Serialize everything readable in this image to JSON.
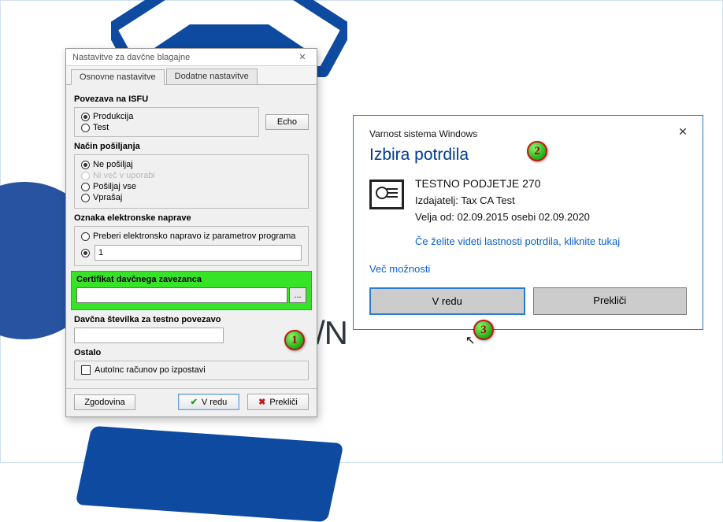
{
  "background": {
    "fragment_text": "/N"
  },
  "settings_window": {
    "title": "Nastavitve za davčne blagajne",
    "tabs": {
      "basic": "Osnovne nastavitve",
      "extra": "Dodatne nastavitve"
    },
    "isfu": {
      "label": "Povezava na ISFU",
      "production": "Produkcija",
      "test": "Test",
      "echo_btn": "Echo"
    },
    "send_mode": {
      "label": "Način pošiljanja",
      "none": "Ne pošiljaj",
      "deprecated": "Ni več v uporabi",
      "all": "Pošiljaj vse",
      "ask": "Vprašaj"
    },
    "device": {
      "label": "Oznaka elektronske naprave",
      "from_params": "Preberi elektronsko napravo iz parametrov programa",
      "value": "1"
    },
    "cert": {
      "label": "Certifikat davčnega zavezanca",
      "value": "",
      "browse": "..."
    },
    "tax_no": {
      "label": "Davčna številka za testno povezavo",
      "value": ""
    },
    "other": {
      "label": "Ostalo",
      "autoinc": "AutoInc računov po izpostavi"
    },
    "footer": {
      "history": "Zgodovina",
      "ok": "V redu",
      "cancel": "Prekliči"
    }
  },
  "security_dialog": {
    "subtitle": "Varnost sistema Windows",
    "heading": "Izbira potrdila",
    "cert": {
      "name": "TESTNO PODJETJE 270",
      "issuer": "Izdajatelj: Tax CA Test",
      "validity": "Velja od: 02.09.2015 osebi 02.09.2020"
    },
    "view_properties_link": "Če želite videti lastnosti potrdila, kliknite tukaj",
    "more_options_link": "Več možnosti",
    "ok": "V redu",
    "cancel": "Prekliči"
  },
  "badges": {
    "one": "1",
    "two": "2",
    "three": "3"
  }
}
